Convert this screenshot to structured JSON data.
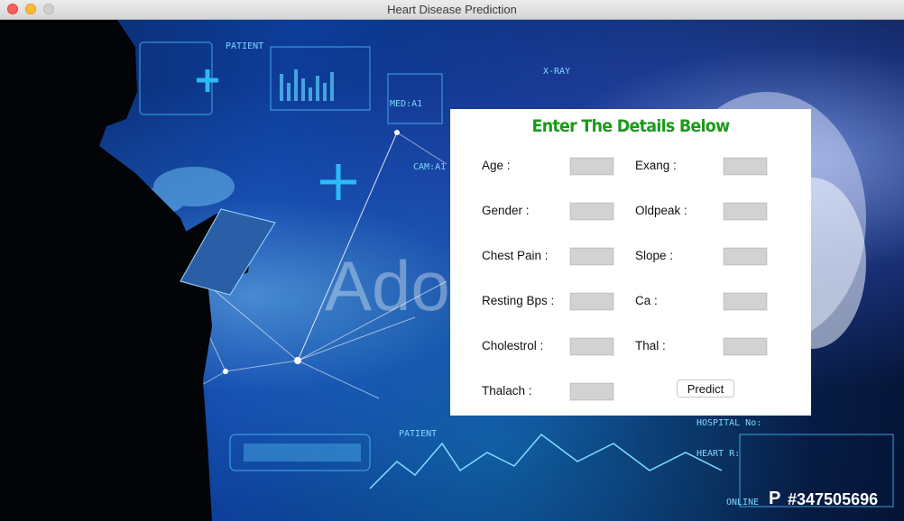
{
  "window": {
    "title": "Heart Disease Prediction"
  },
  "background": {
    "watermark_text": "Ado",
    "stock_logo": "P",
    "stock_id": "#347505696",
    "hud_labels": [
      "PATIENT",
      "X-RAY",
      "MED:A1",
      "CAM:A1",
      "HOSPITAL No:",
      "HEART R:",
      "ONLINE",
      "PATIENT"
    ]
  },
  "form": {
    "title": "Enter The Details Below",
    "left_fields": [
      {
        "label": "Age :",
        "value": ""
      },
      {
        "label": "Gender :",
        "value": ""
      },
      {
        "label": "Chest Pain :",
        "value": ""
      },
      {
        "label": "Resting Bps :",
        "value": ""
      },
      {
        "label": "Cholestrol :",
        "value": ""
      },
      {
        "label": "Thalach :",
        "value": ""
      }
    ],
    "right_fields": [
      {
        "label": "Exang :",
        "value": ""
      },
      {
        "label": "Oldpeak :",
        "value": ""
      },
      {
        "label": "Slope :",
        "value": ""
      },
      {
        "label": "Ca :",
        "value": ""
      },
      {
        "label": "Thal :",
        "value": ""
      }
    ],
    "predict_label": "Predict"
  },
  "colors": {
    "title_green": "#1a9a1a",
    "field_gray": "#d2d2d2",
    "panel_bg": "#ffffff"
  }
}
